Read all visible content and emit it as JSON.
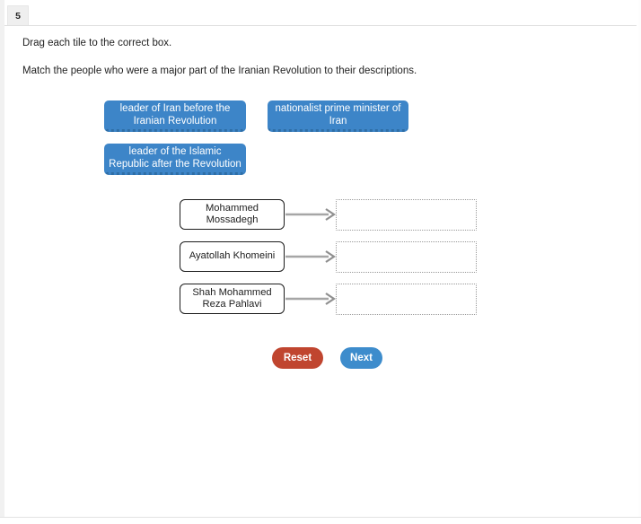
{
  "tab": {
    "label": "5"
  },
  "instructions": {
    "line1": "Drag each tile to the correct box.",
    "line2": "Match the people who were a major part of the Iranian Revolution to their descriptions."
  },
  "tiles": [
    {
      "label": "leader of Iran before the Iranian Revolution"
    },
    {
      "label": "nationalist prime minister of Iran"
    },
    {
      "label": "leader of the Islamic Republic after the Revolution"
    }
  ],
  "matches": [
    {
      "name": "Mohammed Mossadegh",
      "dropped_value": ""
    },
    {
      "name": "Ayatollah Khomeini",
      "dropped_value": ""
    },
    {
      "name": "Shah Mohammed Reza Pahlavi",
      "dropped_value": ""
    }
  ],
  "buttons": {
    "reset_label": "Reset",
    "next_label": "Next"
  },
  "colors": {
    "tile_blue": "#3d85c8",
    "tile_border_blue": "#2f6ea6",
    "reset_red": "#c0452f",
    "next_blue": "#3d8ccc",
    "arrow_gray": "#a6a6a6",
    "dropzone_border": "#9a9a9a",
    "namebox_border": "#1d1d1d"
  }
}
